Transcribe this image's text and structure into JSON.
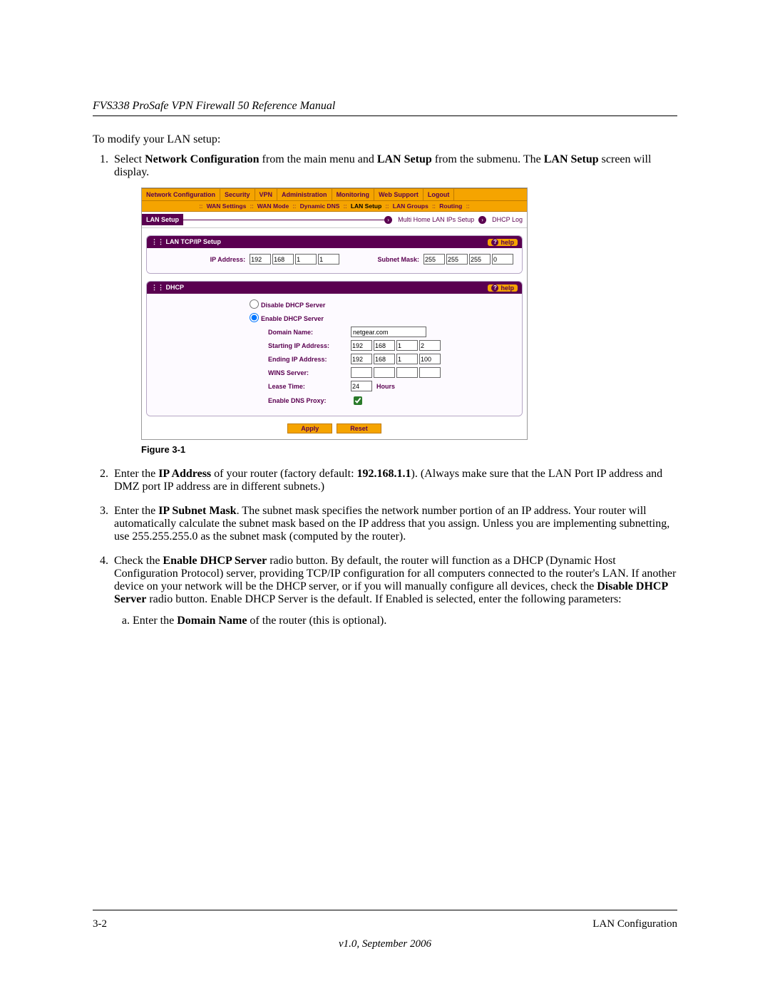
{
  "header": {
    "title": "FVS338 ProSafe VPN Firewall 50 Reference Manual"
  },
  "intro": "To modify your LAN setup:",
  "steps": {
    "s1a": "Select ",
    "s1b": "Network Configuration",
    "s1c": " from the main menu and ",
    "s1d": "LAN Setup",
    "s1e": " from the submenu. The ",
    "s1f": "LAN Setup",
    "s1g": " screen will display.",
    "s2a": "Enter the ",
    "s2b": "IP Address",
    "s2c": " of your router (factory default: ",
    "s2d": "192.168.1.1",
    "s2e": "). (Always make sure that the LAN Port IP address and DMZ port IP address are in different subnets.)",
    "s3a": "Enter the ",
    "s3b": "IP Subnet Mask",
    "s3c": ". The subnet mask specifies the network number portion of an IP address. Your router will automatically calculate the subnet mask based on the IP address that you assign. Unless you are implementing subnetting, use 255.255.255.0 as the subnet mask (computed by the router).",
    "s4a": "Check the ",
    "s4b": "Enable DHCP Server",
    "s4c": " radio button. By default, the router will function as a DHCP (Dynamic Host Configuration Protocol) server, providing TCP/IP configuration for all computers connected to the router's LAN. If another device on your network will be the DHCP server, or if you will manually configure all devices, check the ",
    "s4d": "Disable DHCP Server",
    "s4e": " radio button. Enable DHCP Server is the default. If Enabled is selected, enter the following parameters:",
    "s4_sub_a1": "Enter the ",
    "s4_sub_a2": "Domain Name",
    "s4_sub_a3": " of the router (this is optional)."
  },
  "figure_caption": "Figure 3-1",
  "footer": {
    "page": "3-2",
    "section": "LAN Configuration",
    "version": "v1.0, September 2006"
  },
  "ui": {
    "mainmenu": [
      "Network Configuration",
      "Security",
      "VPN",
      "Administration",
      "Monitoring",
      "Web Support",
      "Logout"
    ],
    "submenu": [
      "WAN Settings",
      "WAN Mode",
      "Dynamic DNS",
      "LAN Setup",
      "LAN Groups",
      "Routing"
    ],
    "submenu_active_index": 3,
    "toolbar": {
      "title": "LAN Setup",
      "link1": "Multi Home LAN IPs Setup",
      "link2": "DHCP Log"
    },
    "panel1": {
      "title": "LAN TCP/IP Setup",
      "help": "help",
      "ip_label": "IP Address:",
      "ip": [
        "192",
        "168",
        "1",
        "1"
      ],
      "mask_label": "Subnet Mask:",
      "mask": [
        "255",
        "255",
        "255",
        "0"
      ]
    },
    "panel2": {
      "title": "DHCP",
      "help": "help",
      "disable": "Disable DHCP Server",
      "enable": "Enable DHCP Server",
      "domain_label": "Domain Name:",
      "domain": "netgear.com",
      "start_label": "Starting IP Address:",
      "start": [
        "192",
        "168",
        "1",
        "2"
      ],
      "end_label": "Ending IP Address:",
      "end": [
        "192",
        "168",
        "1",
        "100"
      ],
      "wins_label": "WINS Server:",
      "wins": [
        "",
        "",
        "",
        ""
      ],
      "lease_label": "Lease Time:",
      "lease_val": "24",
      "lease_unit": "Hours",
      "dnsproxy_label": "Enable DNS Proxy:",
      "dnsproxy_checked": true
    },
    "buttons": {
      "apply": "Apply",
      "reset": "Reset"
    }
  }
}
